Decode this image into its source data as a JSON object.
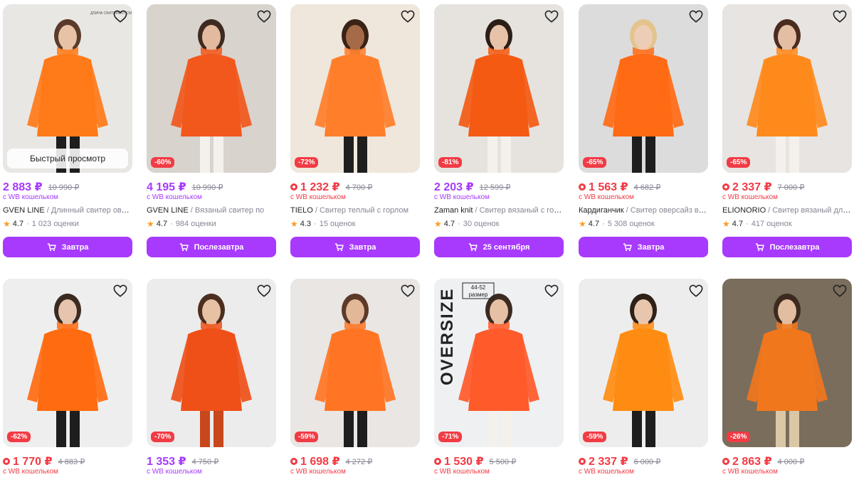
{
  "quick_view_label": "Быстрый просмотр",
  "wallet_label": "с WB кошельком",
  "colors": {
    "accent": "#a73afd",
    "sale": "#f23b44",
    "muted": "#868695",
    "star": "#ff9a1f"
  },
  "products": [
    {
      "brand": "GVEN LINE",
      "desc": " / Длинный свитер оверсайз",
      "price": "2 883 ₽",
      "old_price": "10 990 ₽",
      "price_style": "purple",
      "discount": "",
      "quick_view": true,
      "rating": "4.7",
      "reviews": "1 023 оценки",
      "delivery": "Завтра",
      "overlay_text": "ДЛИНА СВИТЕРА 67 СМ",
      "bg": "#e9e7e4",
      "sweater": "#ff7a18",
      "skin": "#e7c2a6",
      "hair": "#5a3a2a"
    },
    {
      "brand": "GVEN LINE",
      "desc": " / Вязаный свитер по",
      "price": "4 195 ₽",
      "old_price": "10 990 ₽",
      "price_style": "purple",
      "discount": "-60%",
      "quick_view": false,
      "rating": "4.7",
      "reviews": "984 оценки",
      "delivery": "Послезавтра",
      "overlay_text": "",
      "bg": "#d8d3cd",
      "sweater": "#f2571c",
      "skin": "#e3b9a0",
      "hair": "#3e2a20"
    },
    {
      "brand": "TIELO",
      "desc": " / Свитер теплый с горлом",
      "price": "1 232 ₽",
      "old_price": "4 700 ₽",
      "price_style": "red",
      "discount": "-72%",
      "quick_view": false,
      "rating": "4.3",
      "reviews": "15 оценок",
      "delivery": "Завтра",
      "overlay_text": "",
      "bg": "#efe6dc",
      "sweater": "#ff7e2a",
      "skin": "#a56a47",
      "hair": "#3a2216"
    },
    {
      "brand": "Zaman knit",
      "desc": " / Свитер вязаный с горлом",
      "price": "2 203 ₽",
      "old_price": "12 599 ₽",
      "price_style": "purple",
      "discount": "-81%",
      "quick_view": false,
      "rating": "4.7",
      "reviews": "30 оценок",
      "delivery": "25 сентября",
      "overlay_text": "",
      "bg": "#e6e3df",
      "sweater": "#f45a12",
      "skin": "#e6c2a8",
      "hair": "#2b1e17"
    },
    {
      "brand": "Кардиганчик",
      "desc": " / Свитер оверсайз вязаный",
      "price": "1 563 ₽",
      "old_price": "4 682 ₽",
      "price_style": "red",
      "discount": "-65%",
      "quick_view": false,
      "rating": "4.7",
      "reviews": "5 308 оценок",
      "delivery": "Завтра",
      "overlay_text": "",
      "bg": "#dcdcdc",
      "sweater": "#ff6a14",
      "skin": "#edcdb5",
      "hair": "#e3c48d"
    },
    {
      "brand": "ELIONORIO",
      "desc": " / Свитер вязаный длинный",
      "price": "2 337 ₽",
      "old_price": "7 000 ₽",
      "price_style": "red",
      "discount": "-65%",
      "quick_view": false,
      "rating": "4.7",
      "reviews": "417 оценок",
      "delivery": "Послезавтра",
      "overlay_text": "",
      "bg": "#e7e4e1",
      "sweater": "#ff8a1c",
      "skin": "#e3bea4",
      "hair": "#4a2c1e"
    },
    {
      "brand": "",
      "desc": "",
      "price": "1 770 ₽",
      "old_price": "4 883 ₽",
      "price_style": "red",
      "discount": "-62%",
      "quick_view": false,
      "rating": "",
      "reviews": "",
      "delivery": "",
      "overlay_text": "",
      "bg": "#eeeeee",
      "sweater": "#ff6b10",
      "skin": "#e6c4ad",
      "hair": "#3a2a22"
    },
    {
      "brand": "",
      "desc": "",
      "price": "1 353 ₽",
      "old_price": "4 750 ₽",
      "price_style": "purple",
      "discount": "-70%",
      "quick_view": false,
      "rating": "",
      "reviews": "",
      "delivery": "",
      "overlay_text": "",
      "bg": "#ececec",
      "sweater": "#ee5018",
      "skin": "#e7c1a4",
      "hair": "#4a2e1f"
    },
    {
      "brand": "",
      "desc": "",
      "price": "1 698 ₽",
      "old_price": "4 272 ₽",
      "price_style": "red",
      "discount": "-59%",
      "quick_view": false,
      "rating": "",
      "reviews": "",
      "delivery": "",
      "overlay_text": "",
      "bg": "#e9e6e3",
      "sweater": "#ff7524",
      "skin": "#e2b898",
      "hair": "#5c3a27"
    },
    {
      "brand": "",
      "desc": "",
      "price": "1 530 ₽",
      "old_price": "5 500 ₽",
      "price_style": "red",
      "discount": "-71%",
      "quick_view": false,
      "rating": "",
      "reviews": "",
      "delivery": "",
      "overlay_text": "OVERSIZE",
      "overlay_size": "44-52 размер",
      "bg": "#eef0f2",
      "sweater": "#ff5a2a",
      "skin": "#e6c0a5",
      "hair": "#3b2a22"
    },
    {
      "brand": "",
      "desc": "",
      "price": "2 337 ₽",
      "old_price": "6 000 ₽",
      "price_style": "red",
      "discount": "-59%",
      "quick_view": false,
      "rating": "",
      "reviews": "",
      "delivery": "",
      "overlay_text": "",
      "bg": "#ededed",
      "sweater": "#ff8c12",
      "skin": "#e8c6ae",
      "hair": "#2f2118"
    },
    {
      "brand": "",
      "desc": "",
      "price": "2 863 ₽",
      "old_price": "4 000 ₽",
      "price_style": "red",
      "discount": "-26%",
      "quick_view": false,
      "rating": "",
      "reviews": "",
      "delivery": "",
      "overlay_text": "",
      "bg": "#7a6d5c",
      "sweater": "#f1771c",
      "skin": "#e2bda0",
      "hair": "#3d2a1f"
    }
  ]
}
